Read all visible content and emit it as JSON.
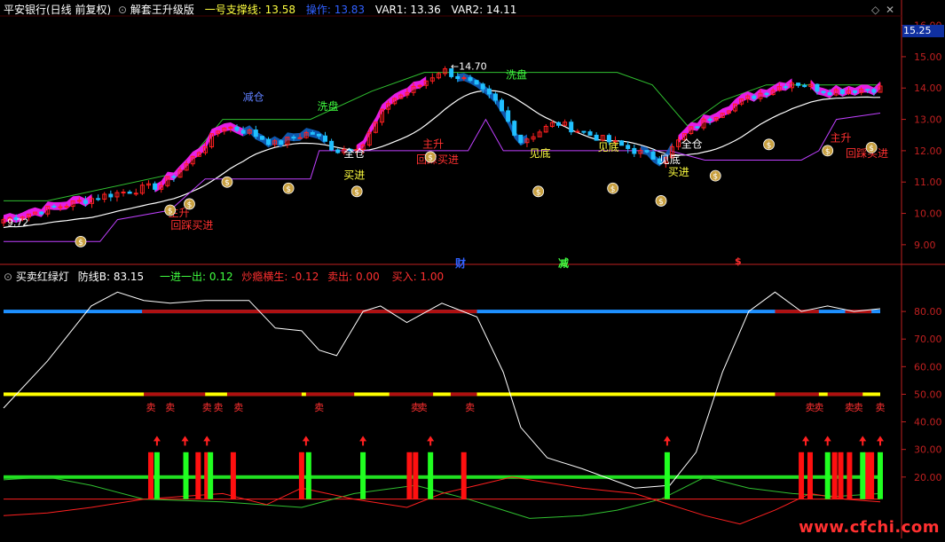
{
  "main_header": {
    "stock": "平安银行(日线 前复权)",
    "indicator": "解套王升级版",
    "support_label": "一号支撑线:",
    "support_value": "13.58",
    "op_label": "操作:",
    "op_value": "13.83",
    "var1": "VAR1: 13.36",
    "var2": "VAR2: 14.11"
  },
  "sub_header": {
    "indicator": "买卖红绿灯",
    "defense": "防线B: 83.15",
    "inout": "一进一出: 0.12",
    "fry": "炒瘾横生: -0.12",
    "sell": "卖出: 0.00",
    "buy": "买入: 1.00"
  },
  "current_price_tag": "15.25",
  "event_markers": {
    "cai": "财",
    "jian": "减",
    "dollar": "$"
  },
  "watermark": "www.cfchi.com",
  "colors": {
    "up": "#ff2020",
    "down": "#20c0ff",
    "magenta": "#ff20ff",
    "purple": "#c040ff",
    "green_line": "#30c030",
    "white": "#ffffff",
    "yellow": "#ffff00",
    "blue_band": "#1e90ff",
    "axis_red": "#c02020",
    "label_red": "#ff3030",
    "label_green": "#40ff40",
    "label_yellow": "#ffff40"
  },
  "chart_data": [
    {
      "type": "candlestick",
      "title": "解套王升级版",
      "ylim": [
        8.6,
        16.3
      ],
      "y_ticks": [
        "16.00",
        "15.00",
        "14.00",
        "13.00",
        "12.00",
        "11.00",
        "10.00",
        "9.00"
      ],
      "low_label": "9.72",
      "high_label": "14.70",
      "annotations": [
        {
          "text": "减仓",
          "kind": "blue",
          "x": 0.285,
          "y": 13.6
        },
        {
          "text": "洗盘",
          "kind": "green",
          "x": 0.37,
          "y": 13.3
        },
        {
          "text": "洗盘",
          "kind": "green",
          "x": 0.585,
          "y": 14.3
        },
        {
          "text": "全仓",
          "kind": "white",
          "x": 0.4,
          "y": 11.8
        },
        {
          "text": "买进",
          "kind": "yellow",
          "x": 0.4,
          "y": 11.1
        },
        {
          "text": "主升",
          "kind": "red",
          "x": 0.49,
          "y": 12.1
        },
        {
          "text": "回踩买进",
          "kind": "red",
          "x": 0.495,
          "y": 11.6
        },
        {
          "text": "见底",
          "kind": "yellow",
          "x": 0.612,
          "y": 11.8
        },
        {
          "text": "见底",
          "kind": "yellow",
          "x": 0.69,
          "y": 12.0
        },
        {
          "text": "见底",
          "kind": "white",
          "x": 0.76,
          "y": 11.6
        },
        {
          "text": "买进",
          "kind": "yellow",
          "x": 0.77,
          "y": 11.2
        },
        {
          "text": "全仓",
          "kind": "white",
          "x": 0.785,
          "y": 12.1
        },
        {
          "text": "主升",
          "kind": "red",
          "x": 0.2,
          "y": 9.9
        },
        {
          "text": "回踩买进",
          "kind": "red",
          "x": 0.215,
          "y": 9.5
        },
        {
          "text": "主升",
          "kind": "red",
          "x": 0.955,
          "y": 12.3
        },
        {
          "text": "回踩买进",
          "kind": "red",
          "x": 0.985,
          "y": 11.8
        }
      ],
      "bags": [
        {
          "x": 0.088,
          "y": 9.1
        },
        {
          "x": 0.19,
          "y": 10.1
        },
        {
          "x": 0.212,
          "y": 10.3
        },
        {
          "x": 0.255,
          "y": 11.0
        },
        {
          "x": 0.325,
          "y": 10.8
        },
        {
          "x": 0.403,
          "y": 10.7
        },
        {
          "x": 0.487,
          "y": 11.8
        },
        {
          "x": 0.61,
          "y": 10.7
        },
        {
          "x": 0.695,
          "y": 10.8
        },
        {
          "x": 0.75,
          "y": 10.4
        },
        {
          "x": 0.812,
          "y": 11.2
        },
        {
          "x": 0.873,
          "y": 12.2
        },
        {
          "x": 0.94,
          "y": 12.0
        },
        {
          "x": 0.99,
          "y": 12.1
        }
      ]
    },
    {
      "type": "line",
      "title": "买卖红绿灯",
      "ylim": [
        0,
        90
      ],
      "y_ticks": [
        "80.00",
        "70.00",
        "60.00",
        "50.00",
        "40.00",
        "30.00",
        "20.00"
      ],
      "sell_label": "卖",
      "sell_marks": [
        0.168,
        0.19,
        0.232,
        0.245,
        0.268,
        0.36,
        0.47,
        0.478,
        0.532,
        0.92,
        0.93,
        0.965,
        0.975,
        1.0
      ],
      "buy_arrows": [
        0.175,
        0.207,
        0.232,
        0.345,
        0.41,
        0.487,
        0.757,
        0.915,
        0.94,
        0.98,
        1.0
      ],
      "red_bars": [
        0.168,
        0.222,
        0.232,
        0.262,
        0.34,
        0.463,
        0.47,
        0.525,
        0.91,
        0.92,
        0.948,
        0.955,
        0.965,
        0.985,
        0.99
      ],
      "green_bars": [
        0.175,
        0.208,
        0.236,
        0.348,
        0.41,
        0.487,
        0.757,
        0.94,
        0.98,
        1.0
      ]
    }
  ]
}
